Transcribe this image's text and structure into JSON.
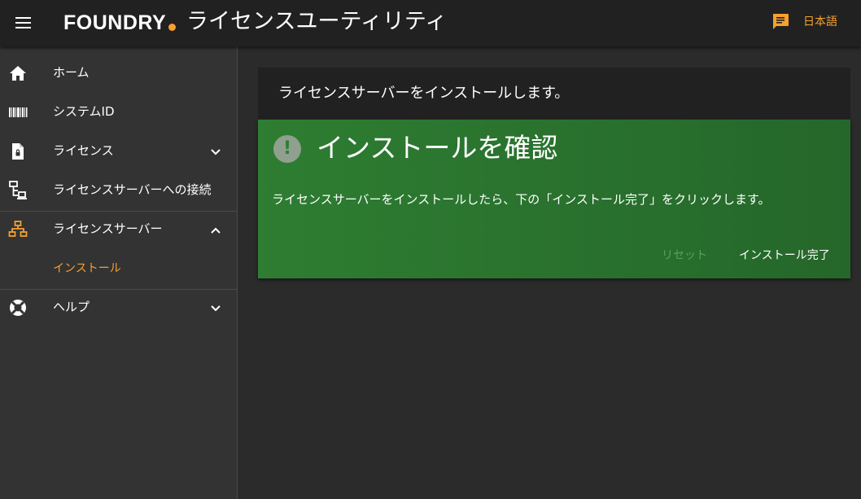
{
  "header": {
    "logo_text": "FOUNDRY",
    "app_title": "ライセンスユーティリティ",
    "language_label": "日本語",
    "menu_icon": "hamburger-menu-icon",
    "language_icon": "chat-bubble-icon"
  },
  "sidebar": {
    "items": [
      {
        "label": "ホーム",
        "icon": "home-icon"
      },
      {
        "label": "システムID",
        "icon": "barcode-icon"
      },
      {
        "label": "ライセンス",
        "icon": "license-file-icon",
        "expandable": true
      },
      {
        "label": "ライセンスサーバーへの接続",
        "icon": "network-connect-icon"
      },
      {
        "label": "ライセンスサーバー",
        "icon": "server-network-icon",
        "expanded": true,
        "active": true
      },
      {
        "label": "ヘルプ",
        "icon": "lifebuoy-icon",
        "expandable": true
      }
    ],
    "sub_items": [
      {
        "label": "インストール",
        "active": true
      }
    ]
  },
  "main": {
    "page_heading": "ライセンスサーバーをインストールします。",
    "card": {
      "icon": "exclamation-circle-icon",
      "icon_mark": "!",
      "title": "インストールを確認",
      "body": "ライセンスサーバーをインストールしたら、下の「インストール完了」をクリックします。",
      "reset_label": "リセット",
      "complete_label": "インストール完了"
    }
  },
  "colors": {
    "accent": "#f5a030",
    "header_bg": "#212121",
    "sidebar_bg": "#333333",
    "content_bg": "#2b2b2b",
    "card_green": "#2e7d32",
    "disabled_green": "#5aa05e"
  }
}
